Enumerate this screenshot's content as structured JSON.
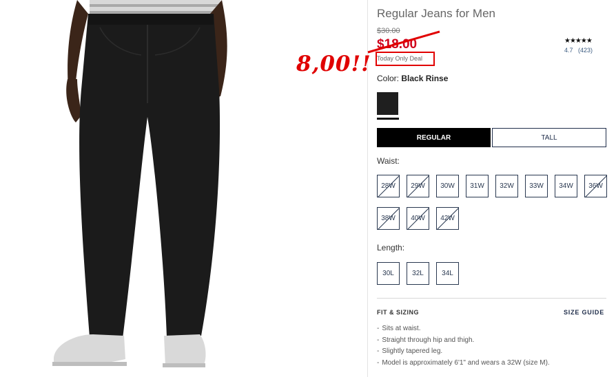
{
  "product": {
    "title": "Regular Jeans for Men",
    "old_price": "$30.00",
    "sale_price": "$18.00",
    "deal": "Today Only Deal",
    "stars": "★★★★★",
    "rating": "4.7",
    "reviews": "(423)",
    "color_label": "Color:",
    "color_name": "Black Rinse",
    "swatch_color": "#1f1f1f"
  },
  "annotation": {
    "text": "8,00!!",
    "color": "#e00000"
  },
  "fit_options": {
    "regular": "REGULAR",
    "tall": "TALL",
    "selected": "REGULAR"
  },
  "waist": {
    "label": "Waist:",
    "sizes": [
      {
        "label": "28W",
        "available": false
      },
      {
        "label": "29W",
        "available": false
      },
      {
        "label": "30W",
        "available": true
      },
      {
        "label": "31W",
        "available": true
      },
      {
        "label": "32W",
        "available": true
      },
      {
        "label": "33W",
        "available": true
      },
      {
        "label": "34W",
        "available": true
      },
      {
        "label": "36W",
        "available": false
      },
      {
        "label": "38W",
        "available": false
      },
      {
        "label": "40W",
        "available": false
      },
      {
        "label": "42W",
        "available": false
      }
    ]
  },
  "length": {
    "label": "Length:",
    "sizes": [
      {
        "label": "30L",
        "available": true
      },
      {
        "label": "32L",
        "available": true
      },
      {
        "label": "34L",
        "available": true
      }
    ]
  },
  "fit_sizing": {
    "title": "FIT & SIZING",
    "size_guide": "SIZE GUIDE",
    "bullets": [
      "Sits at waist.",
      "Straight through hip and thigh.",
      "Slightly tapered leg.",
      "Model is approximately 6'1\" and wears a 32W (size M)."
    ]
  }
}
